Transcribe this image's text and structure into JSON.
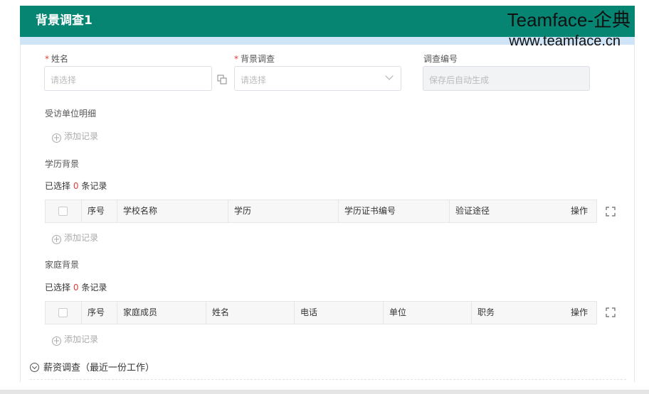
{
  "header": {
    "title": "背景调查1"
  },
  "watermark": {
    "line1": "Teamface-企典",
    "line2": "www.teamface.cn"
  },
  "form": {
    "name_label": "姓名",
    "name_placeholder": "请选择",
    "bg_label": "背景调查",
    "bg_placeholder": "请选择",
    "code_label": "调查编号",
    "code_placeholder": "保存后自动生成",
    "required_mark": "*"
  },
  "sections": {
    "visited": {
      "title": "受访单位明细",
      "add": "添加记录"
    },
    "education": {
      "title": "学历背景",
      "selected_prefix": "已选择",
      "selected_count": "0",
      "selected_suffix": "条记录",
      "columns": [
        "序号",
        "学校名称",
        "学历",
        "学历证书编号",
        "验证途径",
        "操作"
      ],
      "add": "添加记录"
    },
    "family": {
      "title": "家庭背景",
      "selected_prefix": "已选择",
      "selected_count": "0",
      "selected_suffix": "条记录",
      "columns": [
        "序号",
        "家庭成员",
        "姓名",
        "电话",
        "单位",
        "职务",
        "操作"
      ],
      "add": "添加记录"
    },
    "salary": {
      "title": "薪资调查（最近一份工作）"
    }
  },
  "colors": {
    "header_bg": "#058572",
    "required": "#e23c3c"
  }
}
